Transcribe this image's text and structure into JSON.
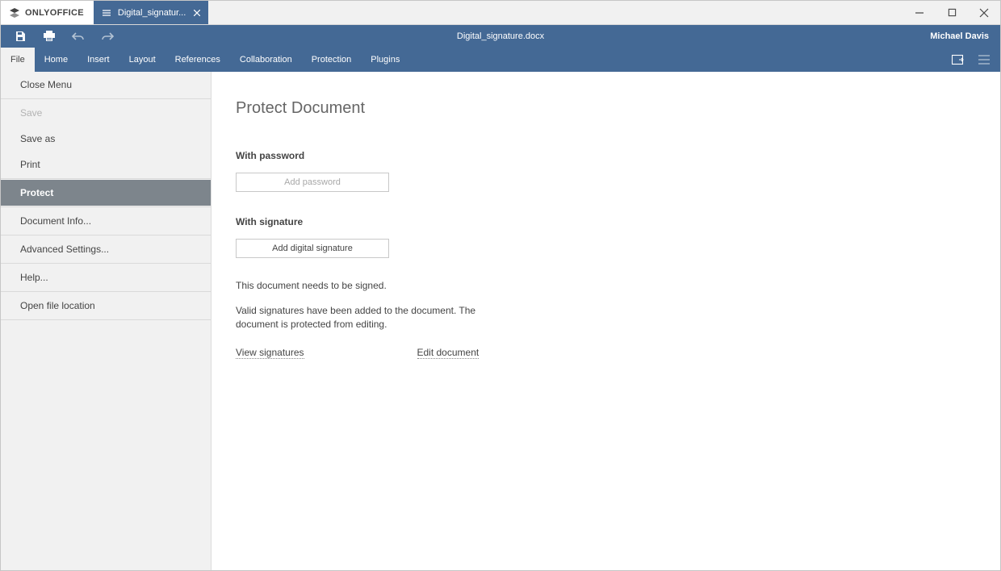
{
  "brand": "ONLYOFFICE",
  "tab_document": "Digital_signatur...",
  "document_title": "Digital_signature.docx",
  "user_name": "Michael Davis",
  "ribbon_tabs": [
    "File",
    "Home",
    "Insert",
    "Layout",
    "References",
    "Collaboration",
    "Protection",
    "Plugins"
  ],
  "sidebar": {
    "close_menu": "Close Menu",
    "save": "Save",
    "save_as": "Save as",
    "print": "Print",
    "protect": "Protect",
    "doc_info": "Document Info...",
    "advanced": "Advanced Settings...",
    "help": "Help...",
    "open_location": "Open file location"
  },
  "panel": {
    "title": "Protect Document",
    "with_password": "With password",
    "add_password": "Add password",
    "with_signature": "With signature",
    "add_signature": "Add digital signature",
    "needs_sign": "This document needs to be signed.",
    "valid_sig": "Valid signatures have been added to the document. The document is protected from editing.",
    "view_signatures": "View signatures",
    "edit_document": "Edit document"
  }
}
